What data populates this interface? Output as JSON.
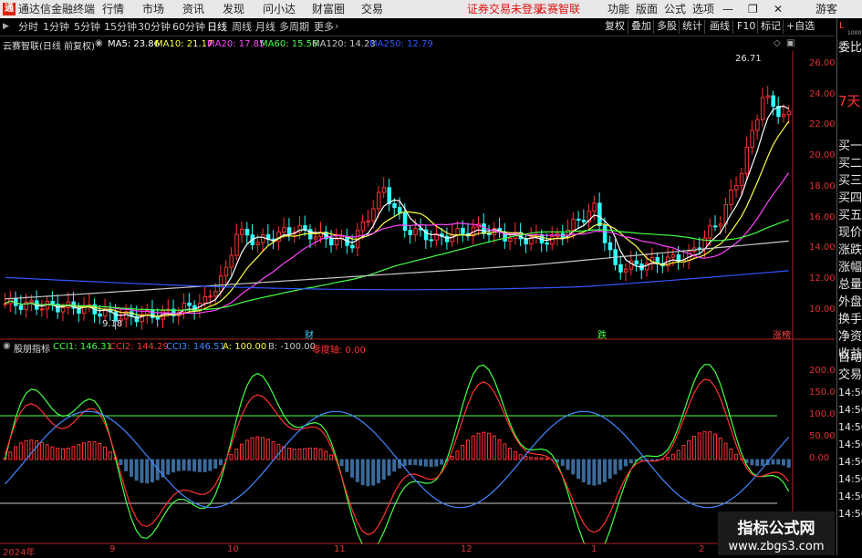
{
  "titlebar": {
    "app_name": "通达信金融终端",
    "menus": [
      "行情",
      "市场",
      "资讯",
      "发现",
      "问小达",
      "财富圈",
      "交易"
    ],
    "notice": "证券交易未登录",
    "stock_name": "云赛智联",
    "right_menus": [
      "功能",
      "版面",
      "公式",
      "选项"
    ],
    "user": "游客"
  },
  "toolbar": {
    "periods": [
      "分时",
      "1分钟",
      "5分钟",
      "15分钟",
      "30分钟",
      "60分钟",
      "日线",
      "周线",
      "月线",
      "多周期",
      "更多"
    ],
    "active_period": "日线",
    "right_buttons": [
      "复权",
      "叠加",
      "多股",
      "统计",
      "画线",
      "F10",
      "标记",
      "+自选"
    ]
  },
  "chart_header": {
    "label": "云赛智联(日线 前复权)",
    "ma": [
      {
        "label": "MA5:",
        "value": "23.86",
        "color": "#ffffff"
      },
      {
        "label": "MA10:",
        "value": "21.17",
        "color": "#ffff44"
      },
      {
        "label": "MA20:",
        "value": "17.85",
        "color": "#ff44ff"
      },
      {
        "label": "MA60:",
        "value": "15.56",
        "color": "#44ff44"
      },
      {
        "label": "MA120:",
        "value": "14.23",
        "color": "#c8c8c8"
      },
      {
        "label": "MA250:",
        "value": "12.79",
        "color": "#3355ff"
      }
    ]
  },
  "price_axis": [
    "26.00",
    "24.00",
    "22.00",
    "20.00",
    "18.00",
    "16.00",
    "14.00",
    "12.00",
    "10.00"
  ],
  "cci_axis": [
    "200.0",
    "150.0",
    "100.0",
    "50.00",
    "0.00"
  ],
  "annotations": {
    "high": "26.71",
    "low": "9.18",
    "events": [
      "财",
      "跌",
      "涨榜"
    ]
  },
  "indicator": {
    "name": "股朋指标",
    "values": [
      {
        "label": "CCI1:",
        "value": "146.31",
        "color": "#44ff44"
      },
      {
        "label": "CCI2:",
        "value": "144.29",
        "color": "#ff3333"
      },
      {
        "label": "CCI3:",
        "value": "146.51",
        "color": "#4488ff"
      },
      {
        "label": "A:",
        "value": "100.00",
        "color": "#ffff44"
      },
      {
        "label": "B:",
        "value": "-100.00",
        "color": "#c8c8c8"
      }
    ],
    "zero_label": "零度轴:",
    "zero_value": "0.00"
  },
  "date_axis": [
    "2024年",
    "9",
    "10",
    "11",
    "12",
    "1",
    "2"
  ],
  "right_panel": {
    "header": "L",
    "sub": "1000",
    "rows": [
      "委比",
      "7天",
      "买一",
      "买二",
      "买三",
      "买四",
      "买五",
      "现价",
      "涨跌",
      "涨幅",
      "总量",
      "外盘",
      "换手",
      "净资",
      "收益",
      "自动",
      "交易"
    ],
    "times": [
      "14:56",
      "14:56",
      "14:56",
      "14:56",
      "14:56",
      "14:56",
      "14:56",
      "14:56"
    ]
  },
  "watermark": {
    "line1": "指标公式网",
    "line2": "www.zbgs3.com"
  },
  "colors": {
    "up": "#ff3333",
    "down": "#33ffff",
    "ma250": "#3355ff",
    "axis_text": "#dd3333"
  }
}
